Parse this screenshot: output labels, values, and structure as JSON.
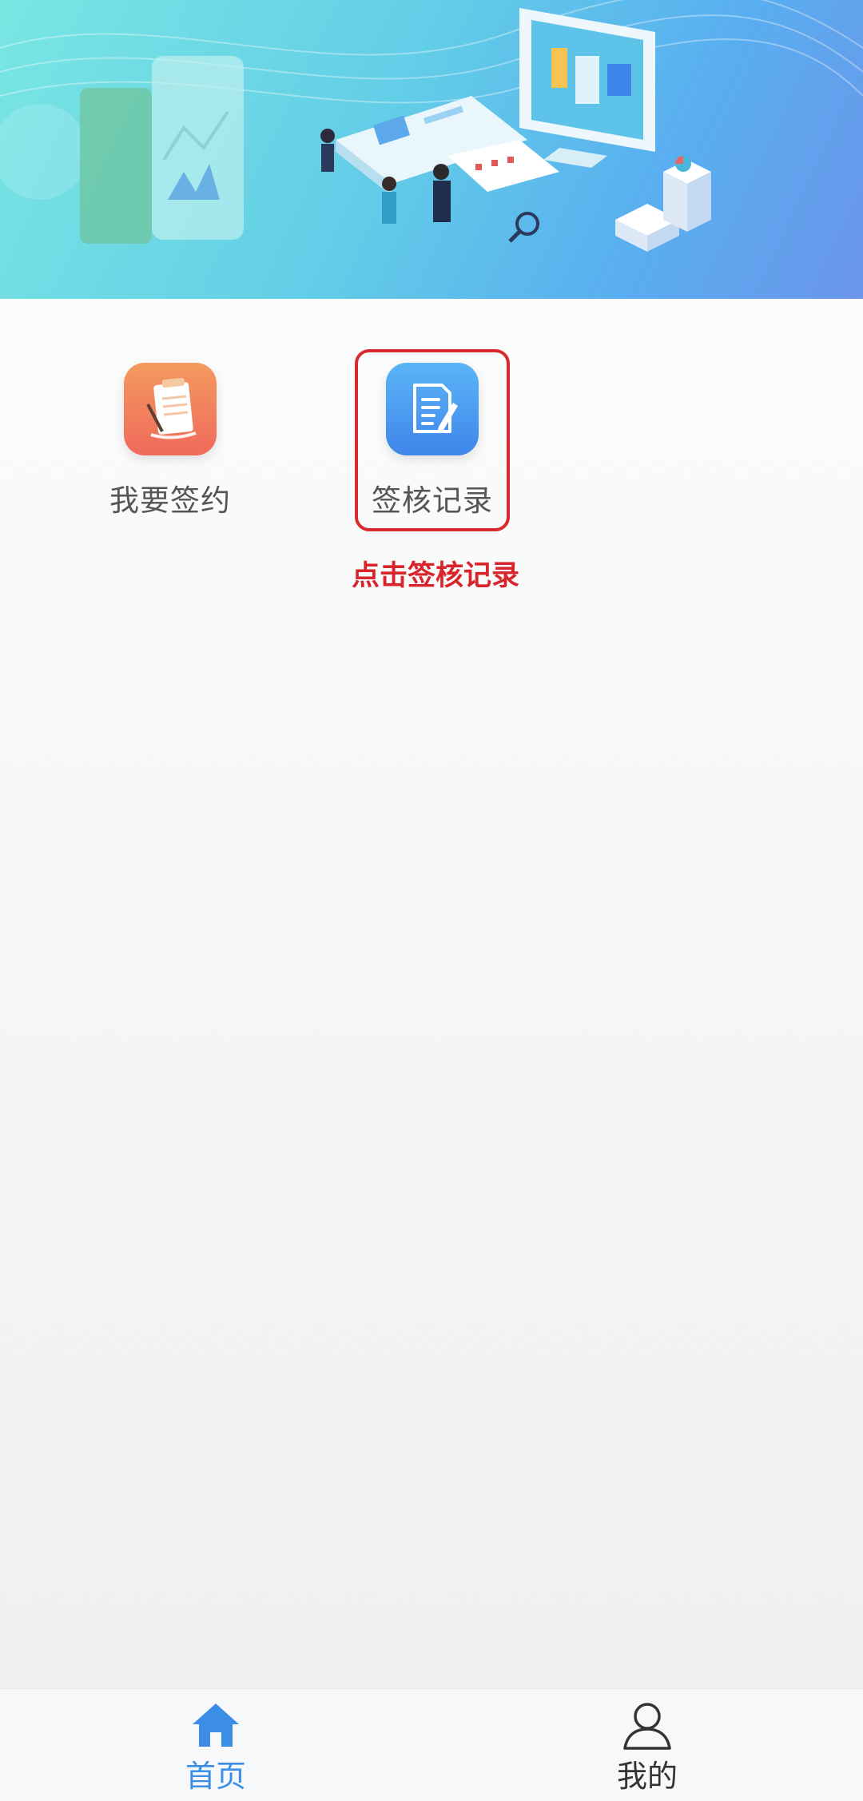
{
  "banner": {
    "illustration": "office-business-illustration"
  },
  "menu": {
    "items": [
      {
        "label": "我要签约",
        "icon": "clipboard-sign-icon",
        "color": "#ef7a5c"
      },
      {
        "label": "签核记录",
        "icon": "document-edit-icon",
        "color": "#4a95ef"
      }
    ]
  },
  "annotation": {
    "text": "点击签核记录",
    "color": "#d8242a"
  },
  "tabbar": {
    "tabs": [
      {
        "label": "首页",
        "icon": "home-icon",
        "active": true,
        "color": "#3b8de6"
      },
      {
        "label": "我的",
        "icon": "user-icon",
        "active": false,
        "color": "#333333"
      }
    ]
  }
}
